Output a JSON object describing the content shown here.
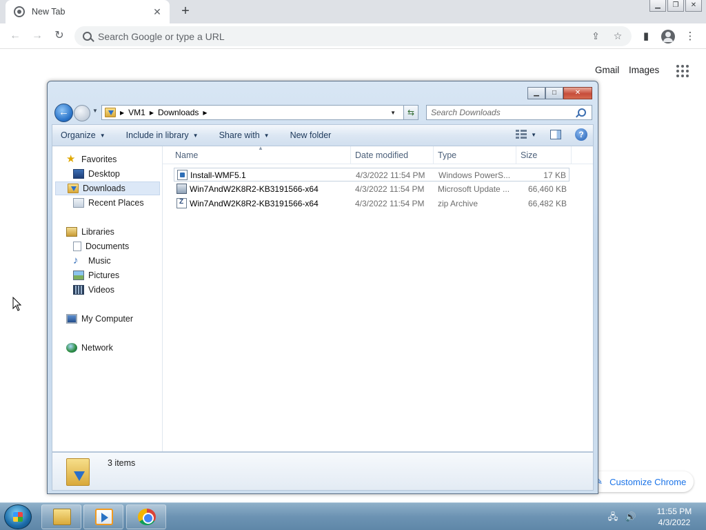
{
  "chrome": {
    "tab_title": "New Tab",
    "new_tab_symbol": "+",
    "omnibox_placeholder": "Search Google or type a URL",
    "gmail_label": "Gmail",
    "images_label": "Images",
    "customize_label": "Customize Chrome"
  },
  "explorer": {
    "breadcrumbs": [
      "VM1",
      "Downloads"
    ],
    "search_placeholder": "Search Downloads",
    "commands": {
      "organize": "Organize",
      "include_in_library": "Include in library",
      "share_with": "Share with",
      "new_folder": "New folder"
    },
    "nav": {
      "favorites": "Favorites",
      "desktop": "Desktop",
      "downloads": "Downloads",
      "recent_places": "Recent Places",
      "libraries": "Libraries",
      "documents": "Documents",
      "music": "Music",
      "pictures": "Pictures",
      "videos": "Videos",
      "my_computer": "My Computer",
      "network": "Network"
    },
    "columns": {
      "name": "Name",
      "date_modified": "Date modified",
      "type": "Type",
      "size": "Size"
    },
    "files": [
      {
        "name": "Install-WMF5.1",
        "date": "4/3/2022 11:54 PM",
        "type": "Windows PowerS...",
        "size": "17 KB",
        "icon": "powershell-script-icon"
      },
      {
        "name": "Win7AndW2K8R2-KB3191566-x64",
        "date": "4/3/2022 11:54 PM",
        "type": "Microsoft Update ...",
        "size": "66,460 KB",
        "icon": "msu-file-icon"
      },
      {
        "name": "Win7AndW2K8R2-KB3191566-x64",
        "date": "4/3/2022 11:54 PM",
        "type": "zip Archive",
        "size": "66,482 KB",
        "icon": "zip-file-icon"
      }
    ],
    "item_count": "3 items"
  },
  "taskbar": {
    "time": "11:55 PM",
    "date": "4/3/2022"
  }
}
